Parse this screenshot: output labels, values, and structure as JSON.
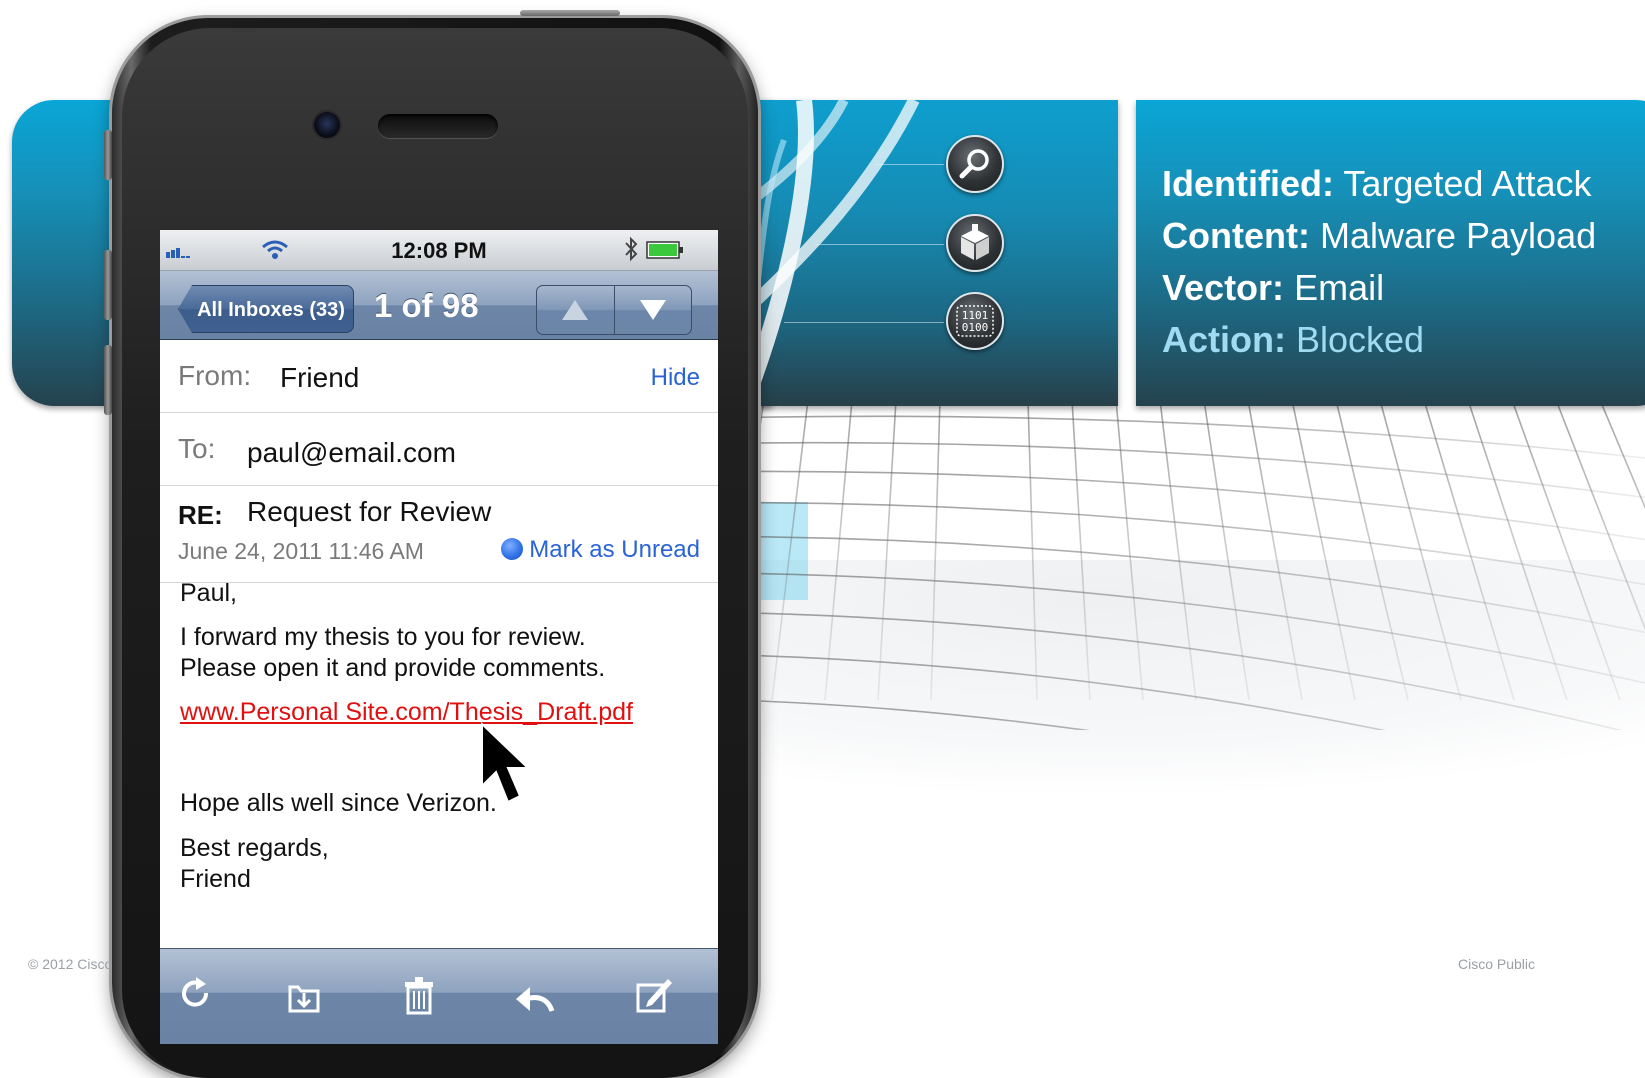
{
  "footer": {
    "copyright": "© 2012 Cisco",
    "classification": "Cisco Public"
  },
  "threat_panel": {
    "rows": [
      {
        "label": "Identified:",
        "value": "Targeted Attack"
      },
      {
        "label": "Content:",
        "value": "Malware Payload"
      },
      {
        "label": "Vector:",
        "value": "Email"
      },
      {
        "label": "Action:",
        "value": "Blocked"
      }
    ],
    "icons": [
      "magnifier-icon",
      "package-icon",
      "binary-data-icon"
    ],
    "binary_text": [
      "1101",
      "0100"
    ],
    "colors": {
      "panel_blue": "#0aa6d6",
      "action_highlight": "#9fdcf3"
    }
  },
  "phone": {
    "status_bar": {
      "time": "12:08 PM"
    },
    "nav": {
      "back_label": "All Inboxes (33)",
      "counter": "1 of 98"
    },
    "email": {
      "from_label": "From:",
      "from_value": "Friend",
      "hide_label": "Hide",
      "to_label": "To:",
      "to_value": "paul@email.com",
      "subject_prefix": "RE:",
      "subject": "Request for Review",
      "date": "June 24, 2011 11:46 AM",
      "mark_unread": "Mark as Unread",
      "greeting": "Paul,",
      "line1": "I forward my thesis to you for review.",
      "line2": "Please open it and provide comments.",
      "link": "www.Personal Site.com/Thesis_Draft.pdf",
      "line3": "Hope alls well since Verizon.",
      "signoff1": "Best regards,",
      "signoff2": "Friend"
    },
    "colors": {
      "link": "#e01010",
      "ios_blue": "#2a64d4"
    }
  }
}
